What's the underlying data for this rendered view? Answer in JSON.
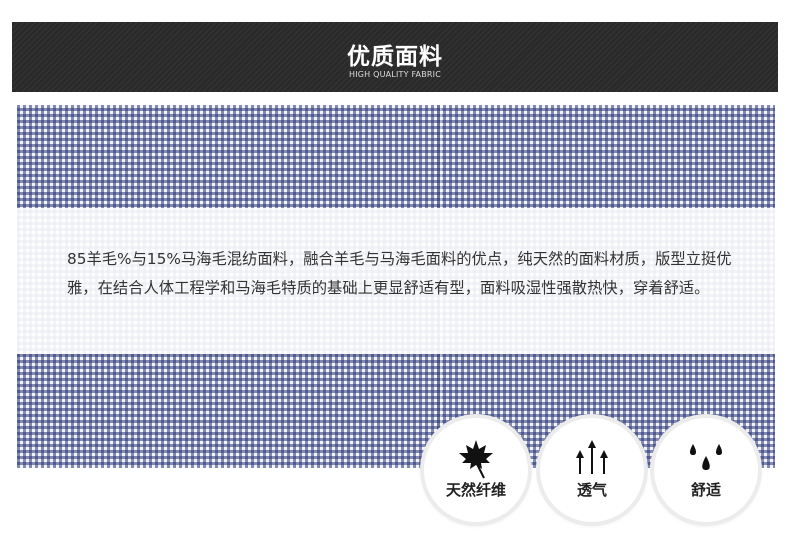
{
  "header": {
    "title": "优质面料",
    "subtitle": "HIGH QUALITY FABRIC"
  },
  "description": "85羊毛%与15%马海毛混纺面料，融合羊毛与马海毛面料的优点，纯天然的面料材质，版型立挺优雅，在结合人体工程学和马海毛特质的基础上更显舒适有型，面料吸湿性强散热快，穿着舒适。",
  "features": [
    {
      "label": "天然纤维",
      "icon": "maple-leaf-icon"
    },
    {
      "label": "透气",
      "icon": "upward-arrows-icon"
    },
    {
      "label": "舒适",
      "icon": "water-drops-icon"
    }
  ],
  "colors": {
    "header_bg": "#2a2a2a",
    "fabric_check": "#28347a"
  }
}
